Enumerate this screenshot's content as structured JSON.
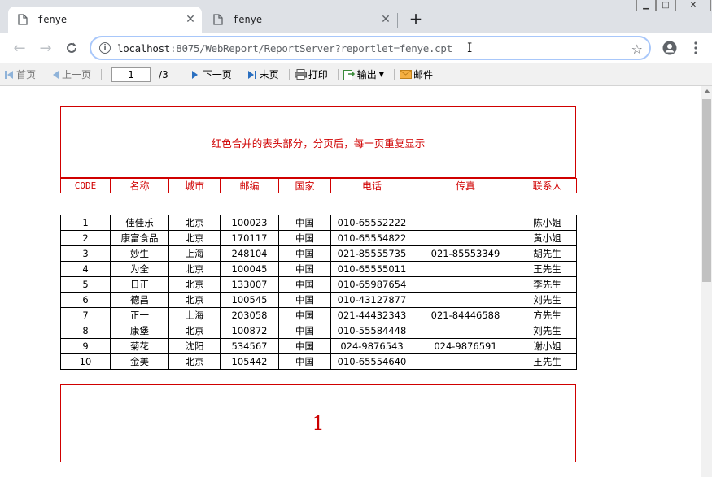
{
  "browser": {
    "tabs": [
      {
        "title": "fenye",
        "active": true
      },
      {
        "title": "fenye",
        "active": false
      }
    ],
    "url_host": "localhost",
    "url_rest": ":8075/WebReport/ReportServer?reportlet=fenye.cpt"
  },
  "toolbar": {
    "first": "首页",
    "prev": "上一页",
    "page_value": "1",
    "total": "/3",
    "next": "下一页",
    "last": "末页",
    "print": "打印",
    "export": "输出",
    "mail": "邮件"
  },
  "report": {
    "header_title": "红色合并的表头部分，分页后，每一页重复显示",
    "columns": [
      "CODE",
      "名称",
      "城市",
      "邮编",
      "国家",
      "电话",
      "传真",
      "联系人"
    ],
    "rows": [
      [
        "1",
        "佳佳乐",
        "北京",
        "100023",
        "中国",
        "010-65552222",
        "",
        "陈小姐"
      ],
      [
        "2",
        "康富食品",
        "北京",
        "170117",
        "中国",
        "010-65554822",
        "",
        "黄小姐"
      ],
      [
        "3",
        "妙生",
        "上海",
        "248104",
        "中国",
        "021-85555735",
        "021-85553349",
        "胡先生"
      ],
      [
        "4",
        "为全",
        "北京",
        "100045",
        "中国",
        "010-65555011",
        "",
        "王先生"
      ],
      [
        "5",
        "日正",
        "北京",
        "133007",
        "中国",
        "010-65987654",
        "",
        "李先生"
      ],
      [
        "6",
        "德昌",
        "北京",
        "100545",
        "中国",
        "010-43127877",
        "",
        "刘先生"
      ],
      [
        "7",
        "正一",
        "上海",
        "203058",
        "中国",
        "021-44432343",
        "021-84446588",
        "方先生"
      ],
      [
        "8",
        "康堡",
        "北京",
        "100872",
        "中国",
        "010-55584448",
        "",
        "刘先生"
      ],
      [
        "9",
        "菊花",
        "沈阳",
        "534567",
        "中国",
        "024-9876543",
        "024-9876591",
        "谢小姐"
      ],
      [
        "10",
        "金美",
        "北京",
        "105442",
        "中国",
        "010-65554640",
        "",
        "王先生"
      ]
    ],
    "footer_page": "1"
  },
  "colors": {
    "header_red": "#d00000",
    "omnibox_border": "#a8c7fa"
  }
}
